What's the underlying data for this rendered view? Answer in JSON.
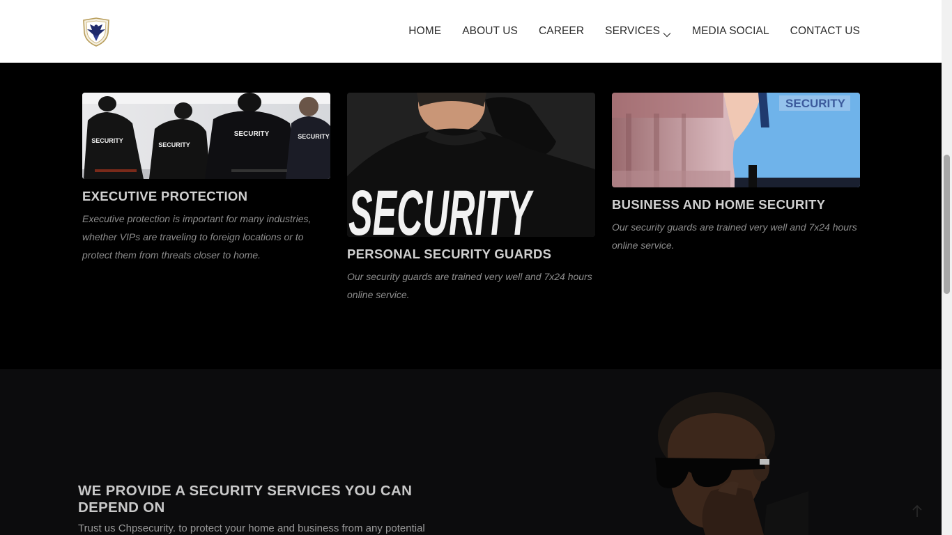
{
  "nav": {
    "items": [
      {
        "label": "HOME"
      },
      {
        "label": "ABOUT US"
      },
      {
        "label": "CAREER"
      },
      {
        "label": "SERVICES"
      },
      {
        "label": "MEDIA SOCIAL"
      },
      {
        "label": "CONTACT US"
      }
    ]
  },
  "services": {
    "cards": [
      {
        "title": "EXECUTIVE PROTECTION",
        "description": "Executive protection is important for many industries, whether VIPs are traveling to foreign locations or to protect them from threats closer to home.",
        "image_text": "SECURITY"
      },
      {
        "title": "PERSONAL SECURITY GUARDS",
        "description": "Our security guards are trained very well and 7x24 hours online service.",
        "image_text": "SECURITY"
      },
      {
        "title": "BUSINESS AND HOME SECURITY",
        "description": "Our security guards are trained very well and 7x24 hours online service.",
        "image_text": "SECURITY"
      }
    ]
  },
  "provide": {
    "title": "WE PROVIDE A SECURITY SERVICES YOU CAN DEPEND ON",
    "text": "Trust us Chpsecurity. to protect your home and business from any potential"
  },
  "colors": {
    "header_bg": "#ffffff",
    "section_bg": "#000000",
    "provide_bg": "#0c0c0d",
    "card_title": "#d0d0d0",
    "card_desc": "#8d8d8d"
  },
  "icons": {
    "logo": "eagle-shield-logo",
    "services_dropdown": "chevron-down-icon",
    "to_top": "arrow-up-icon"
  }
}
